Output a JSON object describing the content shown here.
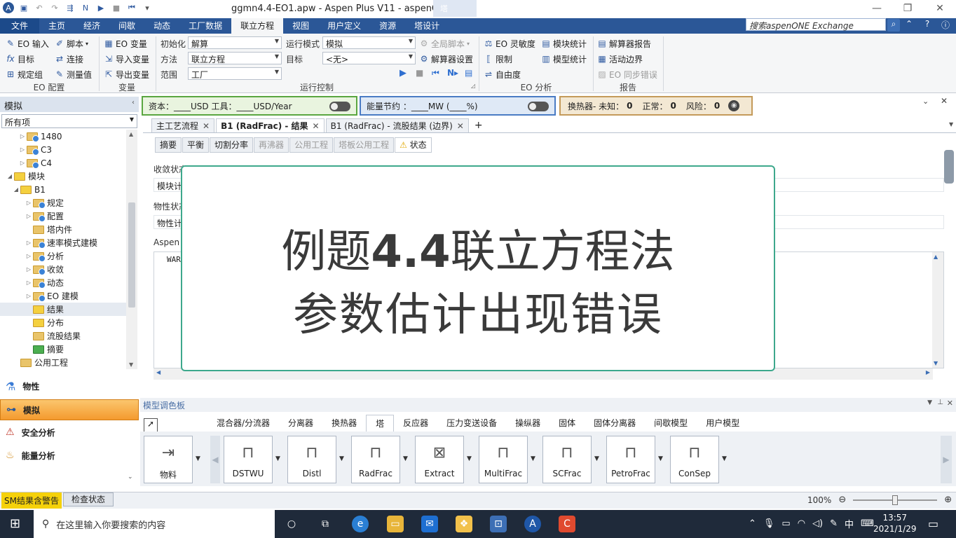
{
  "window": {
    "title": "ggmn4.4-EO1.apw - Aspen Plus V11 - aspenONE",
    "contextual_tab": "塔"
  },
  "ribbon_tabs": [
    "文件",
    "主页",
    "经济",
    "间歇",
    "动态",
    "工厂数据",
    "联立方程",
    "视图",
    "用户定义",
    "资源",
    "塔设计"
  ],
  "search_placeholder": "搜索aspenONE Exchange",
  "ribbon": {
    "eo_config": {
      "items": [
        "EO 输入",
        "脚本",
        "目标",
        "连接",
        "规定组",
        "测量值"
      ],
      "label": "EO 配置"
    },
    "variables": {
      "items": [
        "EO 变量",
        "导入变量",
        "导出变量"
      ],
      "label": "变量"
    },
    "run_control": {
      "init_label": "初始化",
      "init_value": "解算",
      "method_label": "方法",
      "method_value": "联立方程",
      "scope_label": "范围",
      "scope_value": "工厂",
      "mode_label": "运行模式",
      "mode_value": "模拟",
      "target_label": "目标",
      "target_value": "<无>",
      "global_script": "全局脚本",
      "solver_settings": "解算器设置",
      "label": "运行控制"
    },
    "eo_analysis": {
      "items": [
        "EO 灵敏度",
        "模块统计",
        "限制",
        "模型统计",
        "自由度"
      ],
      "label": "EO 分析"
    },
    "report": {
      "items": [
        "解算器报告",
        "活动边界",
        "EO 同步错误"
      ],
      "label": "报告"
    }
  },
  "navigator": {
    "header": "模拟",
    "filter": "所有项",
    "tree": [
      {
        "label": "1480",
        "indent": 2,
        "icon": "blue",
        "exp": "▷"
      },
      {
        "label": "C3",
        "indent": 2,
        "icon": "blue",
        "exp": "▷"
      },
      {
        "label": "C4",
        "indent": 2,
        "icon": "blue",
        "exp": "▷"
      },
      {
        "label": "模块",
        "indent": 0,
        "icon": "warn",
        "exp": "◢"
      },
      {
        "label": "B1",
        "indent": 1,
        "icon": "warn",
        "exp": "◢"
      },
      {
        "label": "规定",
        "indent": 3,
        "icon": "blue",
        "exp": "▷"
      },
      {
        "label": "配置",
        "indent": 3,
        "icon": "blue",
        "exp": "▷"
      },
      {
        "label": "塔内件",
        "indent": 3,
        "icon": "plain",
        "exp": ""
      },
      {
        "label": "速率模式建模",
        "indent": 3,
        "icon": "blue",
        "exp": "▷"
      },
      {
        "label": "分析",
        "indent": 3,
        "icon": "blue",
        "exp": "▷"
      },
      {
        "label": "收敛",
        "indent": 3,
        "icon": "blue",
        "exp": "▷"
      },
      {
        "label": "动态",
        "indent": 3,
        "icon": "blue",
        "exp": "▷"
      },
      {
        "label": "EO 建模",
        "indent": 3,
        "icon": "blue",
        "exp": "▷"
      },
      {
        "label": "结果",
        "indent": 3,
        "icon": "warn",
        "exp": "",
        "sel": true
      },
      {
        "label": "分布",
        "indent": 3,
        "icon": "warn",
        "exp": ""
      },
      {
        "label": "流股结果",
        "indent": 3,
        "icon": "plain",
        "exp": ""
      },
      {
        "label": "摘要",
        "indent": 3,
        "icon": "check",
        "exp": ""
      },
      {
        "label": "公用工程",
        "indent": 1,
        "icon": "plain",
        "exp": ""
      }
    ],
    "sections": [
      "物性",
      "模拟",
      "安全分析",
      "能量分析"
    ]
  },
  "banners": {
    "cost": "资本：____USD   工具：____USD/Year",
    "energy": "能量节约 ：____MW    (____%)",
    "hx_label": "换热器- 未知：",
    "hx_unknown": "0",
    "hx_normal_label": "正常：",
    "hx_normal": "0",
    "hx_risk_label": "风险：",
    "hx_risk": "0"
  },
  "doc_tabs": [
    "主工艺流程",
    "B1 (RadFrac) - 结果",
    "B1 (RadFrac) - 流股结果 (边界)"
  ],
  "sub_tabs": [
    "摘要",
    "平衡",
    "切割分率",
    "再沸器",
    "公用工程",
    "塔板公用工程",
    "状态"
  ],
  "content": {
    "conv_label": "收敛状态",
    "conv_value": "模块计",
    "prop_label": "物性状态",
    "prop_value": "物性计",
    "aspen_label": "Aspen P",
    "msg_value": "WAR"
  },
  "overlay": {
    "line1_a": "例题",
    "line1_b": "4.4",
    "line1_c": "联立方程法",
    "line2": "参数估计出现错误"
  },
  "palette": {
    "header": "模型调色板",
    "tabs": [
      "混合器/分流器",
      "分离器",
      "换热器",
      "塔",
      "反应器",
      "压力变送设备",
      "操纵器",
      "固体",
      "固体分离器",
      "间歇模型",
      "用户模型"
    ],
    "models": [
      "物料",
      "DSTWU",
      "Distl",
      "RadFrac",
      "Extract",
      "MultiFrac",
      "SCFrac",
      "PetroFrac",
      "ConSep"
    ]
  },
  "status": {
    "warning": "SM结果含警告",
    "check_button": "检查状态",
    "zoom": "100%"
  },
  "taskbar": {
    "search_placeholder": "在这里输入你要搜索的内容",
    "time": "13:57",
    "date": "2021/1/29",
    "ime": "中"
  }
}
